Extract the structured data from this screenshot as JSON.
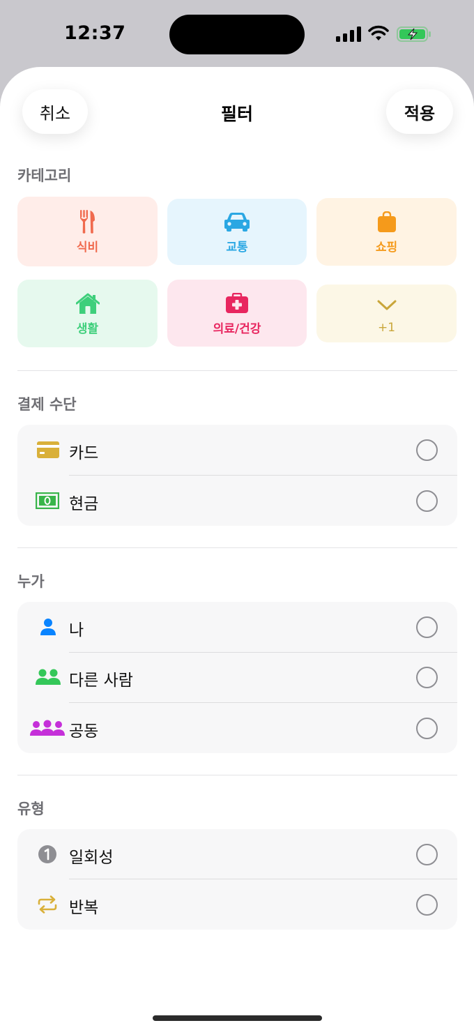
{
  "status_bar": {
    "time": "12:37"
  },
  "nav": {
    "cancel": "취소",
    "title": "필터",
    "apply": "적용"
  },
  "sections": {
    "category": "카테고리",
    "payment": "결제 수단",
    "who": "누가",
    "type": "유형"
  },
  "categories": [
    {
      "label": "식비",
      "icon": "fork-knife-icon",
      "color": "#f06a4e",
      "bg": "#ffede9"
    },
    {
      "label": "교통",
      "icon": "car-icon",
      "color": "#2aa7e3",
      "bg": "#e6f5fd"
    },
    {
      "label": "쇼핑",
      "icon": "shopping-bag-icon",
      "color": "#f59a1b",
      "bg": "#fff3e3"
    },
    {
      "label": "생활",
      "icon": "house-icon",
      "color": "#3ecf7b",
      "bg": "#e6f9ee"
    },
    {
      "label": "의료/건강",
      "icon": "medical-kit-icon",
      "color": "#e8265f",
      "bg": "#fde7ee"
    },
    {
      "label": "+1",
      "icon": "chevron-down-icon",
      "color": "#c9a63a",
      "bg": "#fcf7e6"
    }
  ],
  "payment_methods": [
    {
      "label": "카드",
      "icon": "credit-card-icon",
      "color": "#d9b03a"
    },
    {
      "label": "현금",
      "icon": "banknote-icon",
      "color": "#39b54a"
    }
  ],
  "who": [
    {
      "label": "나",
      "icon": "person-icon",
      "color": "#0a84ff"
    },
    {
      "label": "다른 사람",
      "icon": "two-people-icon",
      "color": "#34c759"
    },
    {
      "label": "공동",
      "icon": "group-icon",
      "color": "#c530d9"
    }
  ],
  "types": [
    {
      "label": "일회성",
      "icon": "number-one-icon",
      "color": "#8e8e93"
    },
    {
      "label": "반복",
      "icon": "repeat-icon",
      "color": "#d9b03a"
    }
  ]
}
